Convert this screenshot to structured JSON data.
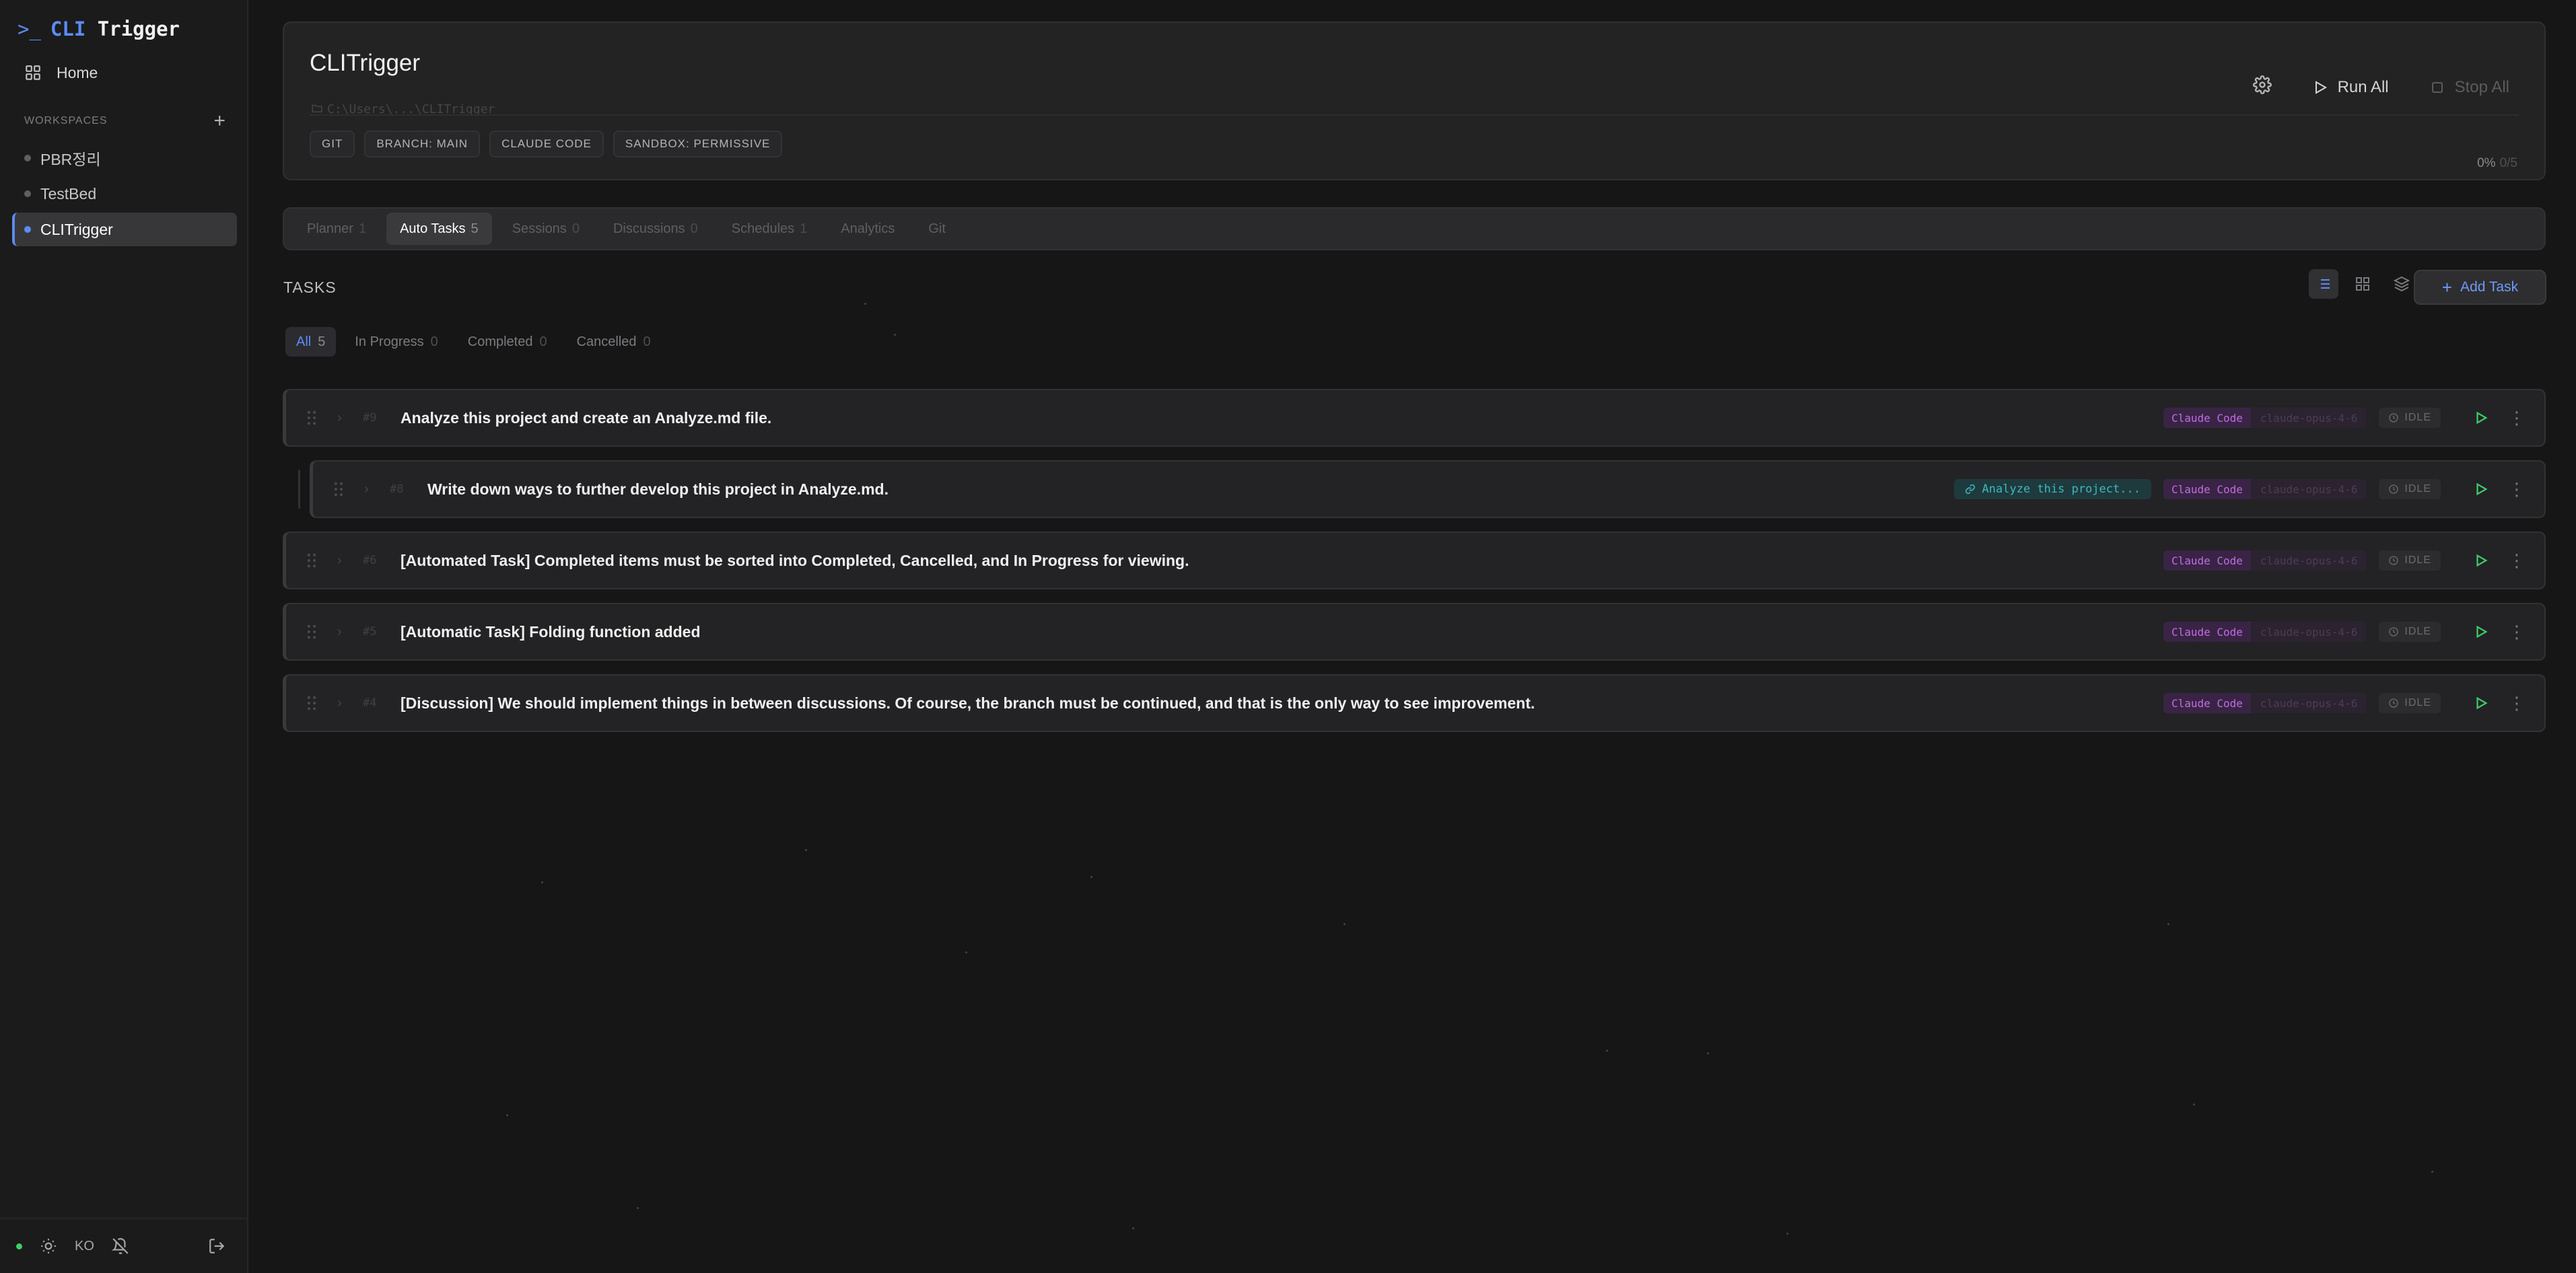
{
  "app": {
    "logo_prompt": ">_",
    "logo_cli": "CLI",
    "logo_rest": "Trigger"
  },
  "sidebar": {
    "home_label": "Home",
    "workspaces_heading": "WORKSPACES",
    "add_symbol": "+",
    "items": [
      {
        "label": "PBR정리",
        "active": false
      },
      {
        "label": "TestBed",
        "active": false
      },
      {
        "label": "CLITrigger",
        "active": true
      }
    ],
    "footer": {
      "lang": "KO"
    }
  },
  "project": {
    "title": "CLITrigger",
    "path": "C:\\Users\\...\\CLITrigger",
    "run_all_label": "Run All",
    "stop_all_label": "Stop All",
    "tags": [
      "GIT",
      "BRANCH: MAIN",
      "CLAUDE CODE",
      "SANDBOX: PERMISSIVE"
    ],
    "progress_percent": "0%",
    "progress_fraction": "0/5"
  },
  "tabs": [
    {
      "label": "Planner",
      "count": "1",
      "active": false
    },
    {
      "label": "Auto Tasks",
      "count": "5",
      "active": true
    },
    {
      "label": "Sessions",
      "count": "0",
      "active": false
    },
    {
      "label": "Discussions",
      "count": "0",
      "active": false
    },
    {
      "label": "Schedules",
      "count": "1",
      "active": false
    },
    {
      "label": "Analytics",
      "count": "",
      "active": false
    },
    {
      "label": "Git",
      "count": "",
      "active": false
    }
  ],
  "tasks_section": {
    "title": "TASKS",
    "add_task_label": "Add Task",
    "filters": [
      {
        "label": "All",
        "count": "5",
        "active": true
      },
      {
        "label": "In Progress",
        "count": "0",
        "active": false
      },
      {
        "label": "Completed",
        "count": "0",
        "active": false
      },
      {
        "label": "Cancelled",
        "count": "0",
        "active": false
      }
    ]
  },
  "tasks": [
    {
      "num": "#9",
      "title": "Analyze this project and create an Analyze.md file.",
      "child": false,
      "link": "",
      "agent": "Claude Code",
      "model": "claude-opus-4-6",
      "status": "IDLE"
    },
    {
      "num": "#8",
      "title": "Write down ways to further develop this project in Analyze.md.",
      "child": true,
      "link": "Analyze this project...",
      "agent": "Claude Code",
      "model": "claude-opus-4-6",
      "status": "IDLE"
    },
    {
      "num": "#6",
      "title": "[Automated Task] Completed items must be sorted into Completed, Cancelled, and In Progress for viewing.",
      "child": false,
      "link": "",
      "agent": "Claude Code",
      "model": "claude-opus-4-6",
      "status": "IDLE"
    },
    {
      "num": "#5",
      "title": "[Automatic Task] Folding function added",
      "child": false,
      "link": "",
      "agent": "Claude Code",
      "model": "claude-opus-4-6",
      "status": "IDLE"
    },
    {
      "num": "#4",
      "title": "[Discussion] We should implement things in between discussions. Of course, the branch must be continued, and that is the only way to see improvement.",
      "child": false,
      "link": "",
      "agent": "Claude Code",
      "model": "claude-opus-4-6",
      "status": "IDLE"
    }
  ],
  "icons": {
    "home": "grid-icon",
    "settings": "gear-icon",
    "run": "play-icon",
    "stop": "square-icon",
    "list_view": "list-icon",
    "grid_view": "grid-icon",
    "layers": "layers-icon",
    "drag": "drag-handle-icon",
    "expand": "chevron-right-icon",
    "link": "link-icon",
    "clock": "clock-icon",
    "more": "more-vertical-icon",
    "theme": "sun-icon",
    "notifications": "bell-off-icon",
    "logout": "logout-icon"
  },
  "colors": {
    "accent": "#5b8cf5",
    "run_green": "#3ecf6b",
    "agent_purple": "#c06de0",
    "link_teal": "#3eb8c1"
  }
}
